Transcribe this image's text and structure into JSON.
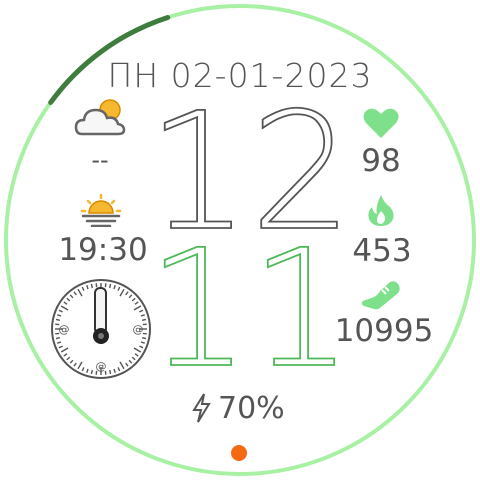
{
  "watch": {
    "date": "ПН 02-01-2023",
    "hour": "12",
    "minute": "11",
    "weather_temp": "--",
    "sunset_time": "19:30",
    "heart_rate": "98",
    "calories": "453",
    "steps": "10995",
    "battery": "70%",
    "battery_level": 0.7,
    "ring_progress": 0.2
  },
  "icons": {
    "weather": "cloud-sun-icon",
    "sunset": "sunset-icon",
    "heart": "heart-icon",
    "calories": "flame-icon",
    "steps": "shoe-icon",
    "battery": "lightning-icon"
  },
  "colors": {
    "ring_base": "#a8f0a4",
    "ring_progress": "#3f7d3f",
    "accent_green": "#7ee08a",
    "text": "#555555",
    "alert_dot": "#f36a12",
    "sun": "#f5b82e"
  }
}
